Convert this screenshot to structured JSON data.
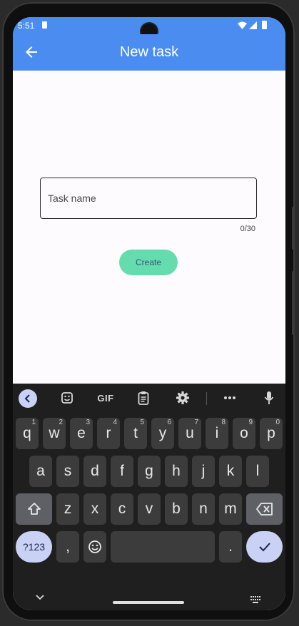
{
  "status_bar": {
    "time": "5:51"
  },
  "app_bar": {
    "title": "New task"
  },
  "form": {
    "task_name_placeholder": "Task name",
    "task_name_value": "",
    "counter": "0/30",
    "create_label": "Create"
  },
  "keyboard": {
    "toolbar": [
      "back-chevron-icon",
      "sticker-icon",
      "gif",
      "clipboard-icon",
      "gear-icon",
      "more-icon",
      "mic-icon"
    ],
    "gif_label": "GIF",
    "row1": [
      {
        "key": "q",
        "hint": "1"
      },
      {
        "key": "w",
        "hint": "2"
      },
      {
        "key": "e",
        "hint": "3"
      },
      {
        "key": "r",
        "hint": "4"
      },
      {
        "key": "t",
        "hint": "5"
      },
      {
        "key": "y",
        "hint": "6"
      },
      {
        "key": "u",
        "hint": "7"
      },
      {
        "key": "i",
        "hint": "8"
      },
      {
        "key": "o",
        "hint": "9"
      },
      {
        "key": "p",
        "hint": "0"
      }
    ],
    "row2": [
      "a",
      "s",
      "d",
      "f",
      "g",
      "h",
      "j",
      "k",
      "l"
    ],
    "row3": [
      "z",
      "x",
      "c",
      "v",
      "b",
      "n",
      "m"
    ],
    "symbols_label": "?123",
    "comma": ",",
    "period": "."
  },
  "colors": {
    "app_bar": "#4a8cf0",
    "create_button": "#64dcae",
    "keyboard_bg": "#1f1f1f",
    "key_bg": "#3c3c3c",
    "accent_key": "#c9d2f5"
  }
}
